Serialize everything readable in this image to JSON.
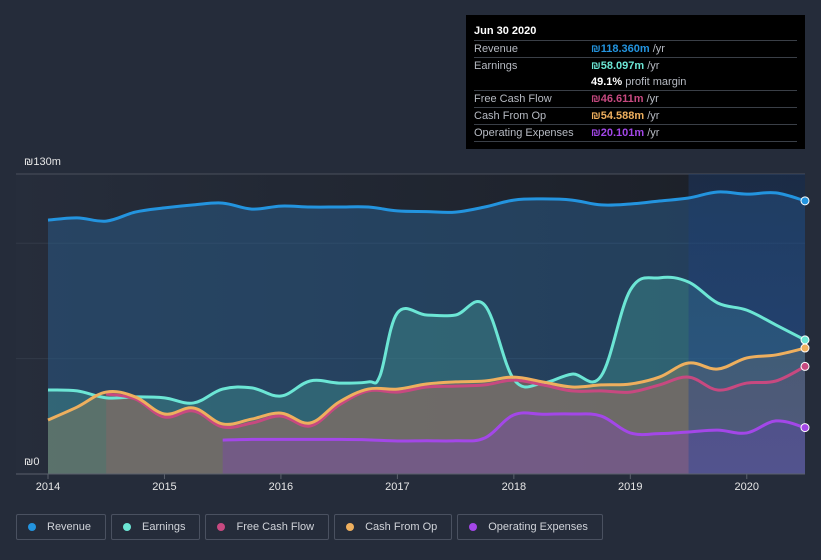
{
  "tooltip": {
    "date": "Jun 30 2020",
    "rows": [
      {
        "label": "Revenue",
        "value": "₪118.360m",
        "unit": " /yr",
        "color": "#2394df"
      },
      {
        "label": "Earnings",
        "value": "₪58.097m",
        "unit": " /yr",
        "color": "#6ce6d5"
      },
      {
        "label": "",
        "value": "49.1%",
        "unit": " profit margin",
        "color": "#ffffff"
      },
      {
        "label": "Free Cash Flow",
        "value": "₪46.611m",
        "unit": " /yr",
        "color": "#c74980"
      },
      {
        "label": "Cash From Op",
        "value": "₪54.588m",
        "unit": " /yr",
        "color": "#eeaf5e"
      },
      {
        "label": "Operating Expenses",
        "value": "₪20.101m",
        "unit": " /yr",
        "color": "#a347e8"
      }
    ]
  },
  "legend": [
    {
      "label": "Revenue",
      "color": "#2394df"
    },
    {
      "label": "Earnings",
      "color": "#6ce6d5"
    },
    {
      "label": "Free Cash Flow",
      "color": "#c74980"
    },
    {
      "label": "Cash From Op",
      "color": "#eeaf5e"
    },
    {
      "label": "Operating Expenses",
      "color": "#a347e8"
    }
  ],
  "chart_data": {
    "type": "area",
    "title": "",
    "xlabel": "",
    "ylabel": "",
    "currency": "₪",
    "y_tick_labels": [
      "₪0",
      "₪130m"
    ],
    "ylim": [
      0,
      130
    ],
    "xlim": [
      2014.0,
      2020.5
    ],
    "x_tick_labels": [
      "2014",
      "2015",
      "2016",
      "2017",
      "2018",
      "2019",
      "2020"
    ],
    "x_ticks": [
      2014,
      2015,
      2016,
      2017,
      2018,
      2019,
      2020
    ],
    "gridlines": [
      50,
      100,
      130
    ],
    "grid": true,
    "highlight_range": [
      2019.5,
      2020.5
    ],
    "legend_position": "bottom-left",
    "series": [
      {
        "name": "Revenue",
        "color": "#2394df",
        "x": [
          2014.0,
          2014.25,
          2014.5,
          2014.75,
          2015.0,
          2015.25,
          2015.5,
          2015.75,
          2016.0,
          2016.25,
          2016.5,
          2016.75,
          2017.0,
          2017.25,
          2017.5,
          2017.75,
          2018.0,
          2018.25,
          2018.5,
          2018.75,
          2019.0,
          2019.25,
          2019.5,
          2019.75,
          2020.0,
          2020.25,
          2020.5
        ],
        "values": [
          110,
          111,
          109.6,
          113.5,
          115.3,
          116.6,
          117.4,
          114.8,
          116.1,
          115.7,
          115.7,
          115.7,
          114.0,
          113.7,
          113.5,
          115.7,
          118.7,
          119.2,
          118.7,
          116.6,
          117.0,
          118.3,
          119.6,
          122.2,
          121.3,
          121.8,
          118.36
        ]
      },
      {
        "name": "Earnings",
        "color": "#6ce6d5",
        "x": [
          2014.0,
          2014.25,
          2014.5,
          2014.75,
          2015.0,
          2015.25,
          2015.5,
          2015.75,
          2016.0,
          2016.25,
          2016.5,
          2016.75,
          2016.85,
          2017.0,
          2017.25,
          2017.5,
          2017.75,
          2018.0,
          2018.25,
          2018.5,
          2018.75,
          2019.0,
          2019.25,
          2019.5,
          2019.75,
          2020.0,
          2020.25,
          2020.5
        ],
        "values": [
          36.4,
          36.0,
          33.0,
          33.4,
          33.0,
          30.8,
          36.8,
          37.3,
          33.8,
          40.3,
          39.4,
          39.9,
          42.5,
          69.8,
          68.9,
          68.9,
          73.2,
          41.0,
          39.4,
          43.3,
          42.5,
          79.7,
          85.0,
          83.2,
          74.1,
          71.0,
          64.6,
          58.097
        ]
      },
      {
        "name": "Free Cash Flow",
        "color": "#c74980",
        "x": [
          2014.5,
          2014.75,
          2015.0,
          2015.25,
          2015.5,
          2015.75,
          2016.0,
          2016.25,
          2016.5,
          2016.75,
          2017.0,
          2017.25,
          2017.5,
          2017.75,
          2018.0,
          2018.25,
          2018.5,
          2018.75,
          2019.0,
          2019.25,
          2019.5,
          2019.75,
          2020.0,
          2020.25,
          2020.5
        ],
        "values": [
          34.7,
          32.5,
          24.7,
          27.3,
          20.4,
          22.1,
          25.1,
          20.8,
          29.9,
          36.0,
          35.5,
          37.7,
          38.1,
          38.6,
          40.7,
          38.6,
          36.0,
          36.0,
          35.5,
          38.6,
          42.0,
          36.4,
          39.4,
          40.3,
          46.611
        ]
      },
      {
        "name": "Cash From Op",
        "color": "#eeaf5e",
        "x": [
          2014.0,
          2014.25,
          2014.5,
          2014.75,
          2015.0,
          2015.25,
          2015.5,
          2015.75,
          2016.0,
          2016.25,
          2016.5,
          2016.75,
          2017.0,
          2017.25,
          2017.5,
          2017.75,
          2018.0,
          2018.25,
          2018.5,
          2018.75,
          2019.0,
          2019.25,
          2019.5,
          2019.75,
          2020.0,
          2020.25,
          2020.5
        ],
        "values": [
          23.4,
          29.0,
          35.5,
          33.4,
          26.0,
          28.6,
          21.7,
          23.8,
          26.4,
          22.1,
          31.2,
          36.8,
          36.8,
          39.0,
          39.9,
          40.3,
          42.0,
          39.9,
          37.7,
          38.6,
          39.0,
          42.0,
          48.1,
          45.5,
          50.3,
          51.6,
          54.588
        ]
      },
      {
        "name": "Operating Expenses",
        "color": "#a347e8",
        "x": [
          2015.5,
          2015.75,
          2016.0,
          2016.25,
          2016.5,
          2016.75,
          2017.0,
          2017.25,
          2017.5,
          2017.75,
          2018.0,
          2018.25,
          2018.5,
          2018.75,
          2019.0,
          2019.25,
          2019.5,
          2019.75,
          2020.0,
          2020.25,
          2020.5
        ],
        "values": [
          14.7,
          15.0,
          15.0,
          15.0,
          15.0,
          14.8,
          14.3,
          14.4,
          14.4,
          15.6,
          25.6,
          25.9,
          26.0,
          25.1,
          17.8,
          17.5,
          18.2,
          19.0,
          17.8,
          23.0,
          20.101
        ]
      }
    ]
  }
}
